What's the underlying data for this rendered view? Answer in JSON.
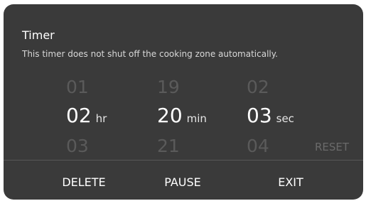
{
  "dialog": {
    "title": "Timer",
    "subtitle": "This timer does not shut off the cooking zone automatically."
  },
  "picker": {
    "hours": {
      "prev": "01",
      "value": "02",
      "next": "03",
      "unit": "hr"
    },
    "minutes": {
      "prev": "19",
      "value": "20",
      "next": "21",
      "unit": "min"
    },
    "seconds": {
      "prev": "02",
      "value": "03",
      "next": "04",
      "unit": "sec"
    },
    "reset_label": "RESET"
  },
  "footer": {
    "delete_label": "DELETE",
    "pause_label": "PAUSE",
    "exit_label": "EXIT"
  },
  "colors": {
    "dialog_bg": "#3a3a3a",
    "text_primary": "#ffffff",
    "text_faded": "#5a5a5a"
  }
}
